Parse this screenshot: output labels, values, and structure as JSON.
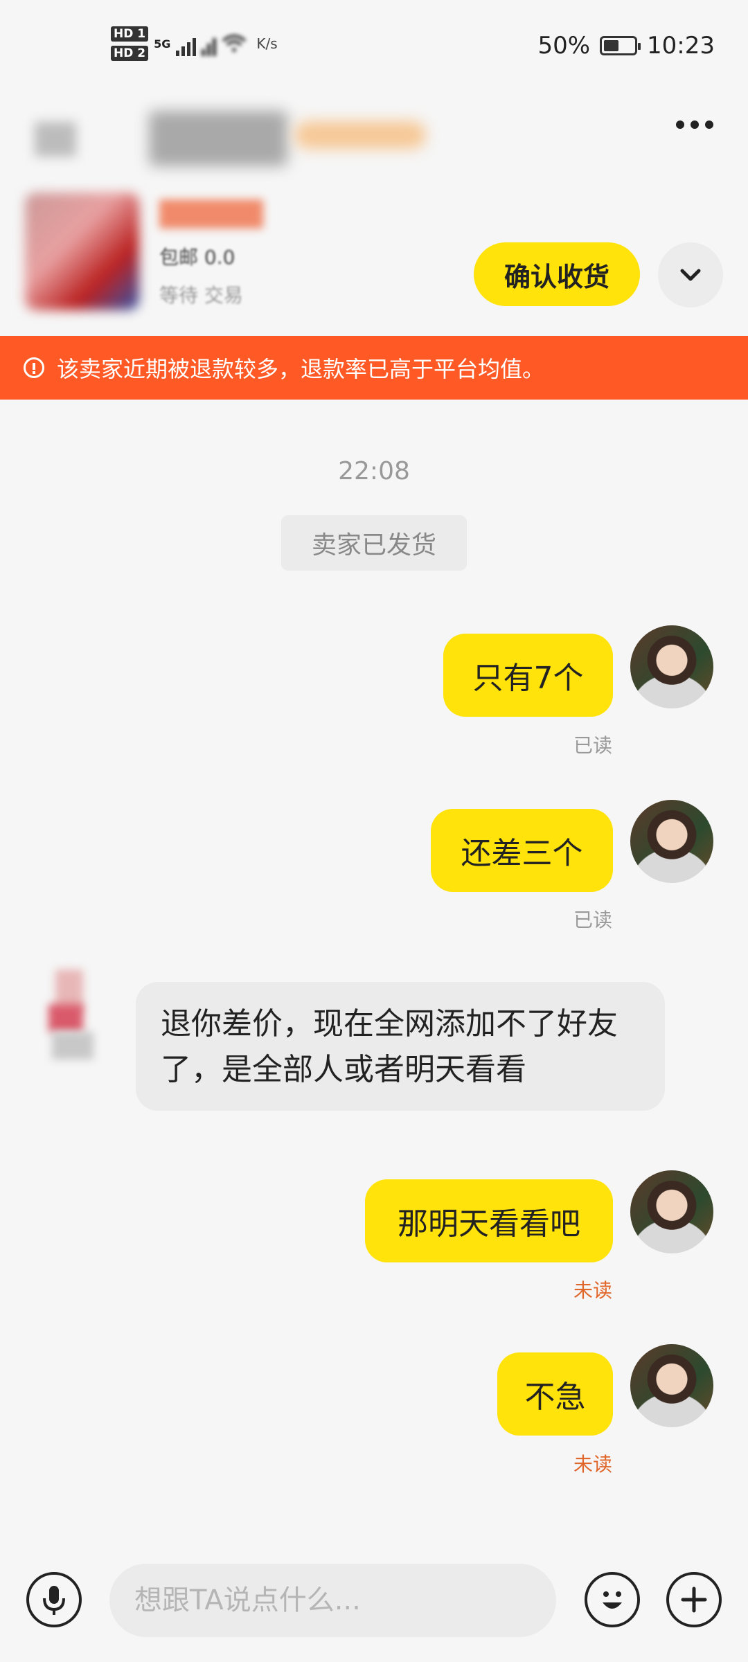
{
  "status_bar": {
    "hd1": "HD 1",
    "hd2": "HD 2",
    "network": "5G",
    "speed_unit": "K/s",
    "battery": "50%",
    "time": "10:23",
    "battery_level": 0.5
  },
  "header": {
    "more_icon": "more-horizontal-icon"
  },
  "order": {
    "confirm_label": "确认收货",
    "expand_icon": "chevron-down-icon",
    "status_line_partial_1": "包邮 0.0",
    "status_line_partial_2": "等待 交易"
  },
  "warning": {
    "text": "该卖家近期被退款较多，退款率已高于平台均值。",
    "icon": "alert-circle-icon"
  },
  "chat": {
    "time": "22:08",
    "system_notice": "卖家已发货",
    "messages": [
      {
        "from": "me",
        "text": "只有7个",
        "status": "已读"
      },
      {
        "from": "me",
        "text": "还差三个",
        "status": "已读"
      },
      {
        "from": "seller",
        "text": "退你差价，现在全网添加不了好友了，是全部人或者明天看看"
      },
      {
        "from": "me",
        "text": "那明天看看吧",
        "status": "未读"
      },
      {
        "from": "me",
        "text": "不急",
        "status": "未读"
      }
    ]
  },
  "input_bar": {
    "placeholder": "想跟TA说点什么...",
    "voice_icon": "microphone-icon",
    "emoji_icon": "emoji-icon",
    "plus_icon": "plus-icon"
  },
  "colors": {
    "accent_yellow": "#ffe30a",
    "warning_orange": "#ff5a26",
    "unread_orange": "#e0662a"
  }
}
